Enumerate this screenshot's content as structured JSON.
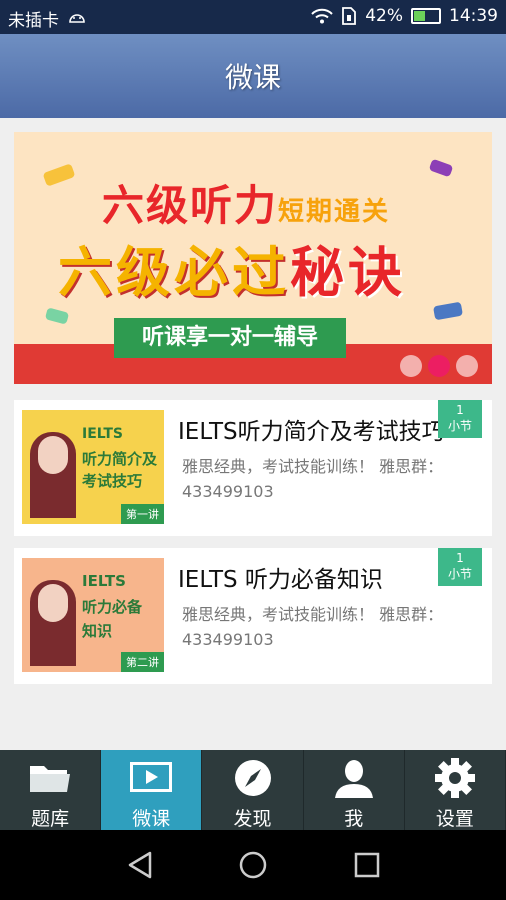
{
  "status_bar": {
    "carrier": "未插卡",
    "battery": "42%",
    "battery_level": 0.42,
    "time": "14:39"
  },
  "header": {
    "title": "微课"
  },
  "banner": {
    "line1_main": "六级听力",
    "line1_small": "短期通关",
    "line2_main": "六级必过",
    "line2_red": "秘诀",
    "ribbon": "听课享一对一辅导",
    "page_count": 3,
    "active_page": 2
  },
  "courses": [
    {
      "thumb_title_1": "IELTS",
      "thumb_title_2": "听力简介及",
      "thumb_title_3": "考试技巧",
      "thumb_tag": "第一讲",
      "title": "IELTS听力简介及考试技巧",
      "desc": "雅思经典，考试技能训练！ 雅思群：433499103",
      "badge_count": "1",
      "badge_unit": "小节"
    },
    {
      "thumb_title_1": "IELTS",
      "thumb_title_2": "听力必备",
      "thumb_title_3": "知识",
      "thumb_tag": "第二讲",
      "title": "IELTS 听力必备知识",
      "desc": "雅思经典，考试技能训练！ 雅思群：433499103",
      "badge_count": "1",
      "badge_unit": "小节"
    }
  ],
  "tabs": [
    {
      "label": "题库",
      "icon": "folder-icon"
    },
    {
      "label": "微课",
      "icon": "video-icon"
    },
    {
      "label": "发现",
      "icon": "compass-icon"
    },
    {
      "label": "我",
      "icon": "person-icon"
    },
    {
      "label": "设置",
      "icon": "gear-icon"
    }
  ],
  "active_tab": 1,
  "colors": {
    "header": "#5b7bb6",
    "tab_active": "#2f9fbe",
    "tab_bar": "#2d3a3c",
    "badge": "#3db88a"
  }
}
